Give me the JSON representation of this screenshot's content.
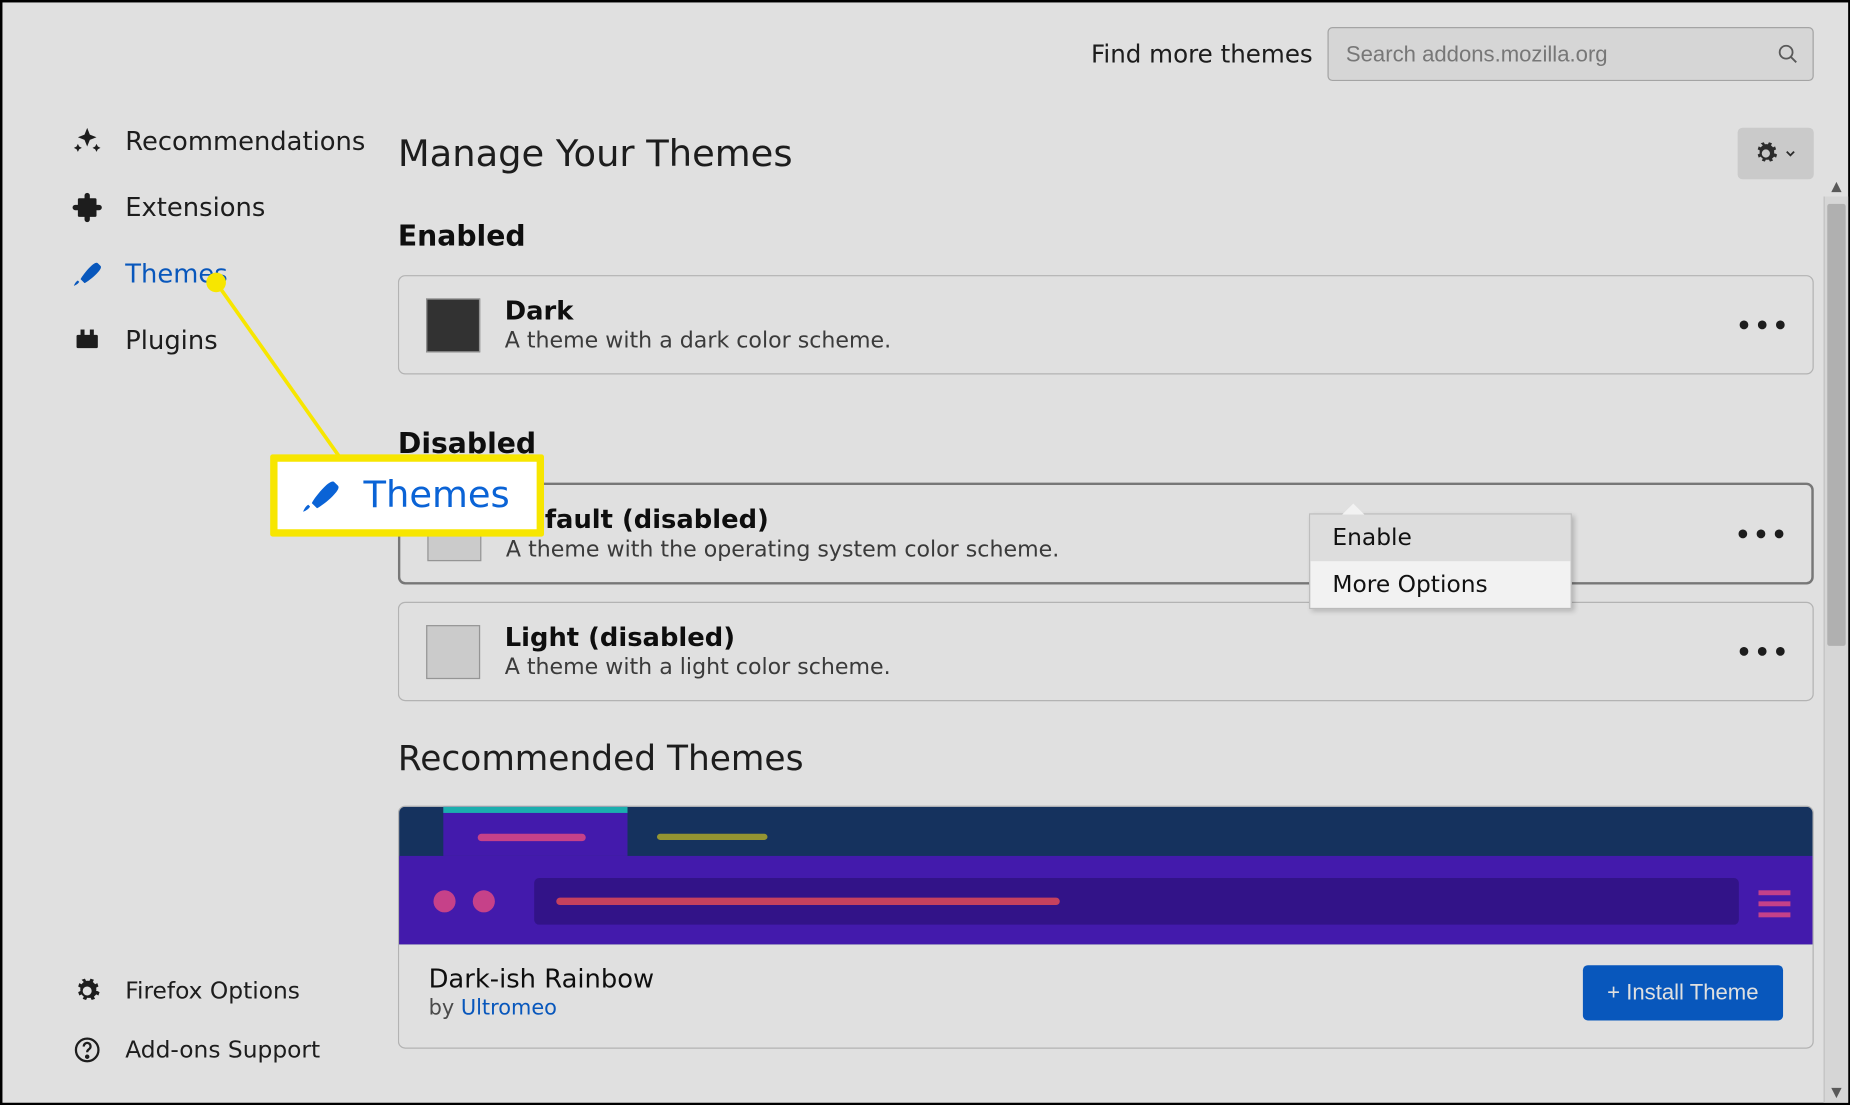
{
  "topbar": {
    "find_label": "Find more themes",
    "search_placeholder": "Search addons.mozilla.org"
  },
  "sidebar": {
    "items": [
      {
        "label": "Recommendations"
      },
      {
        "label": "Extensions"
      },
      {
        "label": "Themes"
      },
      {
        "label": "Plugins"
      }
    ],
    "bottom": [
      {
        "label": "Firefox Options"
      },
      {
        "label": "Add-ons Support"
      }
    ]
  },
  "main": {
    "title": "Manage Your Themes",
    "enabled": {
      "heading": "Enabled",
      "themes": [
        {
          "name": "Dark",
          "desc": "A theme with a dark color scheme."
        }
      ]
    },
    "disabled": {
      "heading": "Disabled",
      "themes": [
        {
          "name": "Default (disabled)",
          "desc": "A theme with the operating system color scheme."
        },
        {
          "name": "Light (disabled)",
          "desc": "A theme with a light color scheme."
        }
      ]
    },
    "recommended": {
      "heading": "Recommended Themes",
      "item": {
        "name": "Dark-ish Rainbow",
        "by_prefix": "by ",
        "author": "Ultromeo",
        "install_label": "+ Install Theme"
      }
    }
  },
  "context_menu": {
    "items": [
      {
        "label": "Enable"
      },
      {
        "label": "More Options"
      }
    ]
  },
  "callout": {
    "label": "Themes"
  }
}
